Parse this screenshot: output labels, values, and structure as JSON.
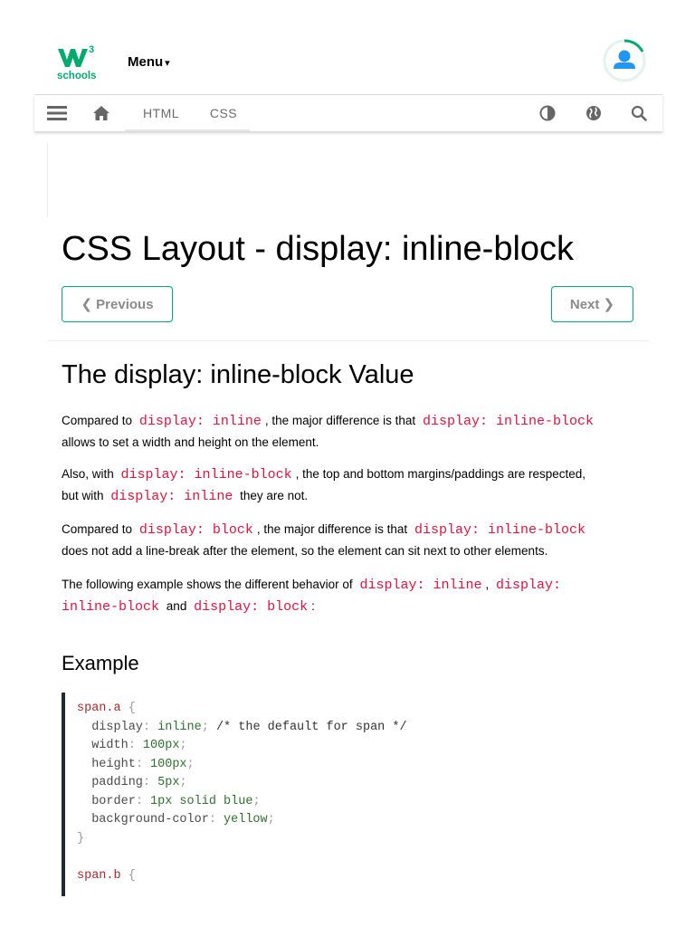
{
  "header": {
    "logo_text": "w3schools",
    "menu_label": "Menu",
    "menu_caret": "▾"
  },
  "nav": {
    "links": [
      {
        "label": "HTML",
        "active": true
      },
      {
        "label": "CSS",
        "active": false
      }
    ],
    "icons": [
      "menu-icon",
      "home-icon",
      "contrast-icon",
      "globe-icon",
      "search-icon"
    ]
  },
  "page": {
    "title": "CSS Layout - display: inline-block",
    "prev_label": "❮ Previous",
    "next_label": "Next ❯",
    "section_title": "The display: inline-block Value",
    "p1": {
      "t1": "Compared to",
      "c1": "display: inline",
      "t2": ", the major difference is that",
      "c2": "display: inline-block",
      "t3": "allows to set a width and height on the element."
    },
    "p2": {
      "t1": "Also, with",
      "c1": "display: inline-block",
      "t2": ", the top and bottom margins/paddings are respected,",
      "t3": "but with",
      "c2": "display: inline",
      "t4": "they are not."
    },
    "p3": {
      "t1": "Compared to",
      "c1": "display: block",
      "t2": ", the major difference is that",
      "c2": "display: inline-block",
      "t3": "does not add a line-break after the element, so the element can sit next to other elements."
    },
    "p4": {
      "t1": "The following example shows the different behavior of",
      "c1": "display: inline",
      "t2": ",",
      "c2a": "display:",
      "c2b": "inline-block",
      "t3": "and",
      "c3": "display: block",
      "t4": ":"
    },
    "example_heading": "Example"
  },
  "code": {
    "lines": [
      [
        {
          "cls": "sel",
          "t": "span.a"
        },
        {
          "cls": "pun",
          "t": " {"
        }
      ],
      [
        {
          "cls": "prop",
          "t": "  display"
        },
        {
          "cls": "pun",
          "t": ": "
        },
        {
          "cls": "val",
          "t": "inline"
        },
        {
          "cls": "pun",
          "t": ";"
        },
        {
          "cls": "cmt",
          "t": " /* the default for span */"
        }
      ],
      [
        {
          "cls": "prop",
          "t": "  width"
        },
        {
          "cls": "pun",
          "t": ": "
        },
        {
          "cls": "val",
          "t": "100px"
        },
        {
          "cls": "pun",
          "t": ";"
        }
      ],
      [
        {
          "cls": "prop",
          "t": "  height"
        },
        {
          "cls": "pun",
          "t": ": "
        },
        {
          "cls": "val",
          "t": "100px"
        },
        {
          "cls": "pun",
          "t": ";"
        }
      ],
      [
        {
          "cls": "prop",
          "t": "  padding"
        },
        {
          "cls": "pun",
          "t": ": "
        },
        {
          "cls": "val",
          "t": "5px"
        },
        {
          "cls": "pun",
          "t": ";"
        }
      ],
      [
        {
          "cls": "prop",
          "t": "  border"
        },
        {
          "cls": "pun",
          "t": ": "
        },
        {
          "cls": "val",
          "t": "1px solid blue"
        },
        {
          "cls": "pun",
          "t": ";"
        }
      ],
      [
        {
          "cls": "prop",
          "t": "  background-color"
        },
        {
          "cls": "pun",
          "t": ": "
        },
        {
          "cls": "val",
          "t": "yellow"
        },
        {
          "cls": "pun",
          "t": ";"
        }
      ],
      [
        {
          "cls": "pun",
          "t": "}"
        }
      ],
      [
        {
          "cls": "pun",
          "t": ""
        }
      ],
      [
        {
          "cls": "sel",
          "t": "span.b"
        },
        {
          "cls": "pun",
          "t": " {"
        }
      ]
    ]
  },
  "colors": {
    "brand_green": "#04aa6d",
    "code_red": "#dc143c",
    "avatar_blue": "#2196f3"
  }
}
